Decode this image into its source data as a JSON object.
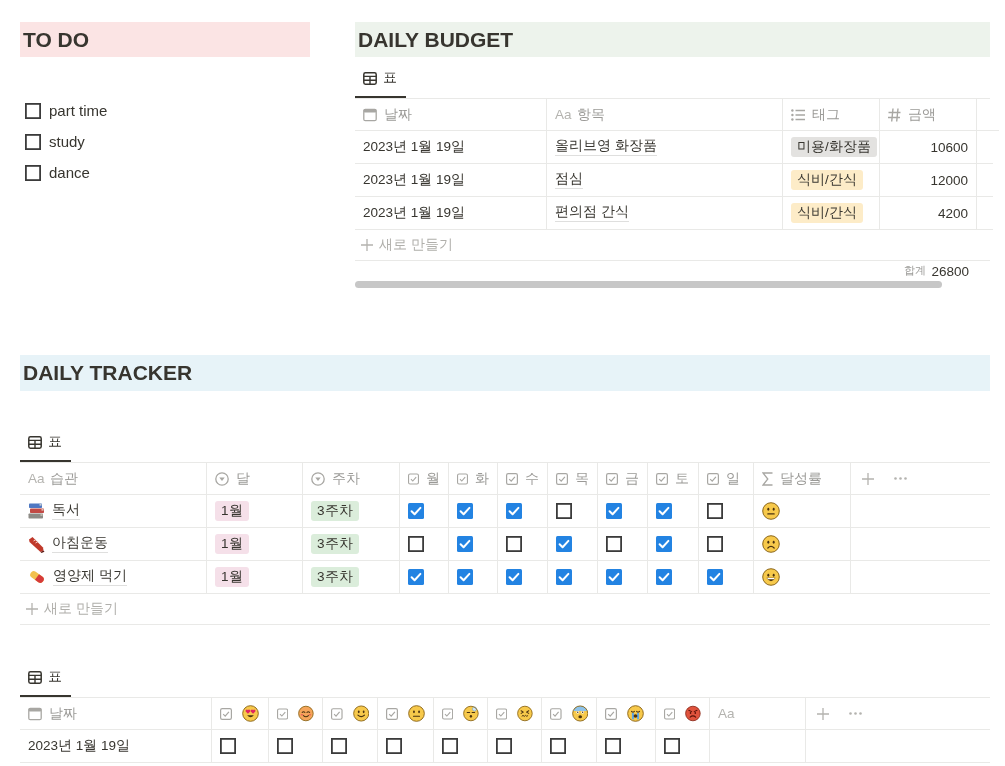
{
  "todo": {
    "title": "TO DO",
    "items": [
      {
        "label": "part time",
        "checked": false
      },
      {
        "label": "study",
        "checked": false
      },
      {
        "label": "dance",
        "checked": false
      }
    ]
  },
  "budget": {
    "title": "DAILY BUDGET",
    "views": [
      {
        "label": "표",
        "selected": true
      }
    ],
    "columns": [
      {
        "kind": "date",
        "label": "날짜"
      },
      {
        "kind": "title",
        "type_mark": "Aa",
        "label": "항목"
      },
      {
        "kind": "multi_select",
        "label": "태그"
      },
      {
        "kind": "number",
        "label": "금액"
      }
    ],
    "rows": [
      {
        "date": "2023년 1월 19일",
        "item": "올리브영 화장품",
        "tag": {
          "label": "미용/화장품",
          "color": "#e3e2e0"
        },
        "amount": "10600"
      },
      {
        "date": "2023년 1월 19일",
        "item": "점심",
        "tag": {
          "label": "식비/간식",
          "color": "#fdecc8"
        },
        "amount": "12000"
      },
      {
        "date": "2023년 1월 19일",
        "item": "편의점 간식",
        "tag": {
          "label": "식비/간식",
          "color": "#fdecc8"
        },
        "amount": "4200"
      }
    ],
    "new_row": "새로 만들기",
    "sum": {
      "label": "합계",
      "value": "26800"
    }
  },
  "tracker": {
    "title": "DAILY TRACKER",
    "views": [
      {
        "label": "표",
        "selected": true
      }
    ],
    "columns": [
      {
        "kind": "title",
        "type_mark": "Aa",
        "label": "습관"
      },
      {
        "kind": "select",
        "label": "달"
      },
      {
        "kind": "select",
        "label": "주차"
      },
      {
        "kind": "checkbox",
        "label": "월"
      },
      {
        "kind": "checkbox",
        "label": "화"
      },
      {
        "kind": "checkbox",
        "label": "수"
      },
      {
        "kind": "checkbox",
        "label": "목"
      },
      {
        "kind": "checkbox",
        "label": "금"
      },
      {
        "kind": "checkbox",
        "label": "토"
      },
      {
        "kind": "checkbox",
        "label": "일"
      },
      {
        "kind": "formula",
        "label": "달성률"
      }
    ],
    "rows": [
      {
        "habit": "독서",
        "month": {
          "label": "1월",
          "color": "#f5e0e9"
        },
        "week": {
          "label": "3주차",
          "color": "#dbeddb"
        },
        "days": [
          {
            "checked": true
          },
          {
            "checked": true
          },
          {
            "checked": true
          },
          {
            "checked": false
          },
          {
            "checked": true
          },
          {
            "checked": true
          },
          {
            "checked": false
          }
        ]
      },
      {
        "habit": "아침운동",
        "month": {
          "label": "1월",
          "color": "#f5e0e9"
        },
        "week": {
          "label": "3주차",
          "color": "#dbeddb"
        },
        "days": [
          {
            "checked": false
          },
          {
            "checked": true
          },
          {
            "checked": false
          },
          {
            "checked": true
          },
          {
            "checked": false
          },
          {
            "checked": true
          },
          {
            "checked": false
          }
        ]
      },
      {
        "habit": "영양제 먹기",
        "month": {
          "label": "1월",
          "color": "#f5e0e9"
        },
        "week": {
          "label": "3주차",
          "color": "#dbeddb"
        },
        "days": [
          {
            "checked": true
          },
          {
            "checked": true
          },
          {
            "checked": true
          },
          {
            "checked": true
          },
          {
            "checked": true
          },
          {
            "checked": true
          },
          {
            "checked": true
          }
        ]
      }
    ],
    "new_row": "새로 만들기"
  },
  "mood_log": {
    "views": [
      {
        "label": "표",
        "selected": true
      }
    ],
    "columns": [
      {
        "kind": "date",
        "label": "날짜"
      },
      {
        "kind": "checkbox"
      },
      {
        "kind": "checkbox"
      },
      {
        "kind": "checkbox"
      },
      {
        "kind": "checkbox"
      },
      {
        "kind": "checkbox"
      },
      {
        "kind": "checkbox"
      },
      {
        "kind": "checkbox"
      },
      {
        "kind": "checkbox"
      },
      {
        "kind": "checkbox"
      },
      {
        "kind": "title",
        "type_mark": "Aa"
      }
    ],
    "rows": [
      {
        "date": "2023년 1월 19일",
        "checks": [
          {
            "checked": false
          },
          {
            "checked": false
          },
          {
            "checked": false
          },
          {
            "checked": false
          },
          {
            "checked": false
          },
          {
            "checked": false
          },
          {
            "checked": false
          },
          {
            "checked": false
          },
          {
            "checked": false
          }
        ]
      }
    ]
  }
}
